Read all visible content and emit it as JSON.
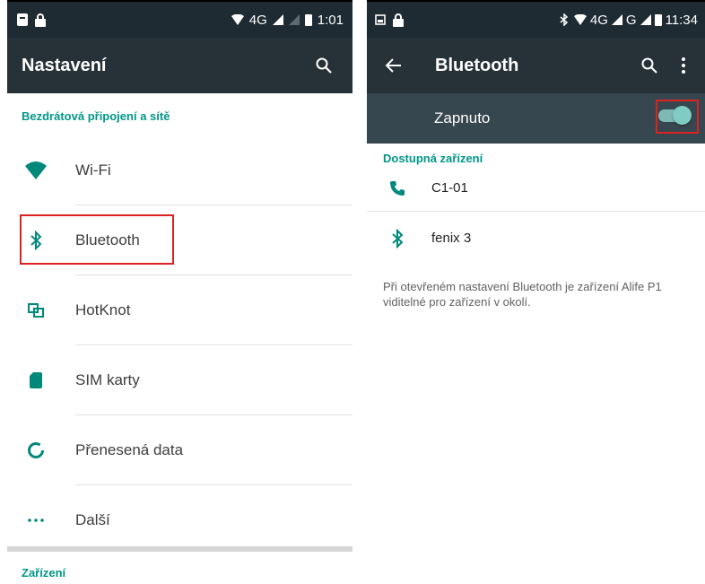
{
  "left": {
    "status": {
      "network": "4G",
      "time": "1:01"
    },
    "appbar": {
      "title": "Nastavení"
    },
    "section_wireless": "Bezdrátová připojení a sítě",
    "items": [
      {
        "label": "Wi-Fi",
        "icon": "wifi-icon"
      },
      {
        "label": "Bluetooth",
        "icon": "bluetooth-icon"
      },
      {
        "label": "HotKnot",
        "icon": "hotknot-icon"
      },
      {
        "label": "SIM karty",
        "icon": "sim-card-icon"
      },
      {
        "label": "Přenesená data",
        "icon": "data-usage-icon"
      },
      {
        "label": "Další",
        "icon": "more-icon"
      }
    ],
    "section_device": "Zařízení"
  },
  "right": {
    "status": {
      "network": "4G",
      "network2": "G",
      "time": "11:34"
    },
    "appbar": {
      "title": "Bluetooth"
    },
    "toggle": {
      "label": "Zapnuto",
      "state": "on"
    },
    "section_available": "Dostupná zařízení",
    "devices": [
      {
        "label": "C1-01",
        "icon": "phone-icon"
      },
      {
        "label": "fenix 3",
        "icon": "bluetooth-icon"
      }
    ],
    "info": "Při otevřeném nastavení Bluetooth je zařízení Alife P1 viditelné pro zařízení v okolí."
  },
  "colors": {
    "accent": "#009688",
    "appbar": "#263238",
    "statusbar": "#1e2b32",
    "highlight": "#dd2222",
    "toggle": "#80cbc4"
  }
}
